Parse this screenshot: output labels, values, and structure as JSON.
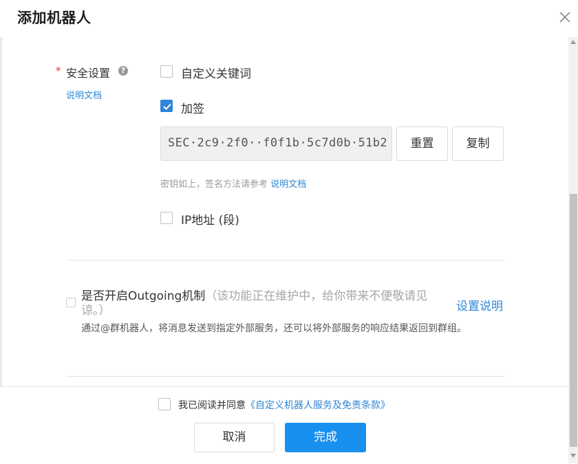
{
  "dialog": {
    "title": "添加机器人"
  },
  "security": {
    "required_mark": "*",
    "label": "安全设置",
    "help_glyph": "?",
    "doc_link": "说明文档",
    "options": {
      "custom_keywords": {
        "label": "自定义关键词",
        "checked": false
      },
      "sign": {
        "label": "加签",
        "checked": true
      },
      "ip": {
        "label": "IP地址 (段)",
        "checked": false
      }
    },
    "secret_value": "SEC·2c9·2f0··f0f1b·5c7d0b·51b2",
    "reset_button": "重置",
    "copy_button": "复制",
    "hint_text": "密钥如上，签名方法请参考 ",
    "hint_link": "说明文档"
  },
  "outgoing": {
    "checked": false,
    "title": "是否开启Outgoing机制",
    "note": "（该功能正在维护中，给你带来不便敬请见谅。）",
    "settings_link": "设置说明",
    "description": "通过@群机器人，将消息发送到指定外部服务，还可以将外部服务的响应结果返回到群组。"
  },
  "footer": {
    "agree_checked": false,
    "agree_text": "我已阅读并同意",
    "agree_link": "《自定义机器人服务及免责条款》",
    "cancel_button": "取消",
    "confirm_button": "完成"
  },
  "colors": {
    "accent": "#2f86d6",
    "primary_button": "#1890f0",
    "required": "#e0362b"
  },
  "icons": [
    "close-icon",
    "help-icon",
    "check-icon",
    "scroll-up-icon",
    "scroll-down-icon"
  ]
}
